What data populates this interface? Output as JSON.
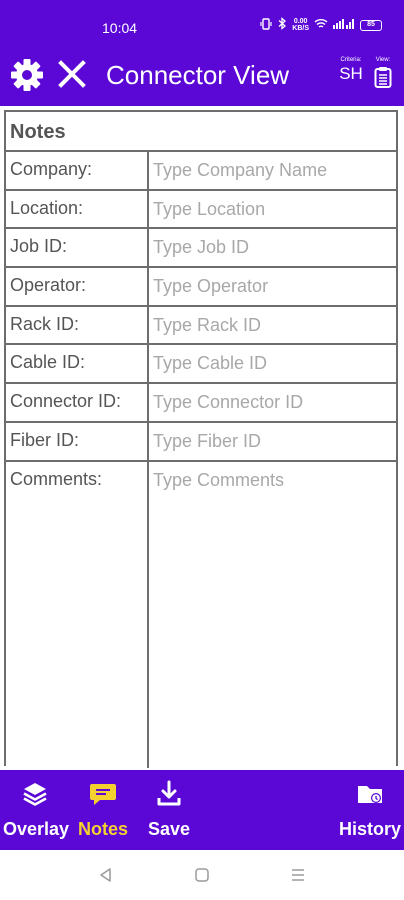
{
  "status_bar": {
    "time": "10:04",
    "speed": "0.00\nKB/S",
    "battery": "85"
  },
  "app_bar": {
    "title": "Connector View",
    "criteria_label": "Criteria:",
    "criteria_value": "SH",
    "view_label": "View:"
  },
  "notes": {
    "header": "Notes",
    "rows": [
      {
        "label": "Company:",
        "placeholder": "Type Company Name"
      },
      {
        "label": "Location:",
        "placeholder": "Type Location"
      },
      {
        "label": "Job ID:",
        "placeholder": "Type Job ID"
      },
      {
        "label": "Operator:",
        "placeholder": "Type Operator"
      },
      {
        "label": "Rack ID:",
        "placeholder": "Type Rack ID"
      },
      {
        "label": "Cable ID:",
        "placeholder": "Type Cable ID"
      },
      {
        "label": "Connector ID:",
        "placeholder": "Type Connector ID"
      },
      {
        "label": "Fiber ID:",
        "placeholder": "Type Fiber ID"
      },
      {
        "label": "Comments:",
        "placeholder": "Type Comments"
      }
    ]
  },
  "bottom_nav": {
    "overlay": "Overlay",
    "notes": "Notes",
    "save": "Save",
    "history": "History"
  },
  "colors": {
    "brand": "#5b08d6",
    "active": "#f5d130"
  }
}
